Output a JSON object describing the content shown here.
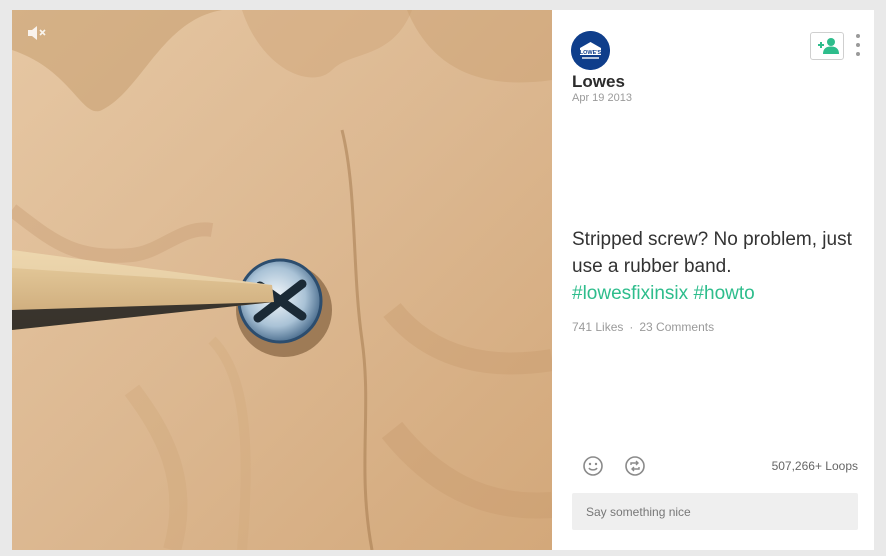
{
  "post": {
    "author": "Lowes",
    "date": "Apr 19 2013",
    "avatar_text": "LOWE'S",
    "caption_text": "Stripped screw? No problem, just use a rubber band.",
    "hashtags": [
      "#lowesfixinsix",
      "#howto"
    ],
    "likes": "741 Likes",
    "separator": "·",
    "comments": "23 Comments",
    "loops": "507,266+ Loops"
  },
  "comment_input": {
    "placeholder": "Say something nice"
  },
  "icons": {
    "mute": "speaker-muted-icon",
    "follow": "add-person-icon",
    "more": "vertical-ellipsis-icon",
    "like": "smiley-icon",
    "revine": "revine-loop-icon"
  },
  "colors": {
    "accent": "#2ebd8c",
    "brand": "#0f3e8b",
    "wood": "#d9b489"
  }
}
